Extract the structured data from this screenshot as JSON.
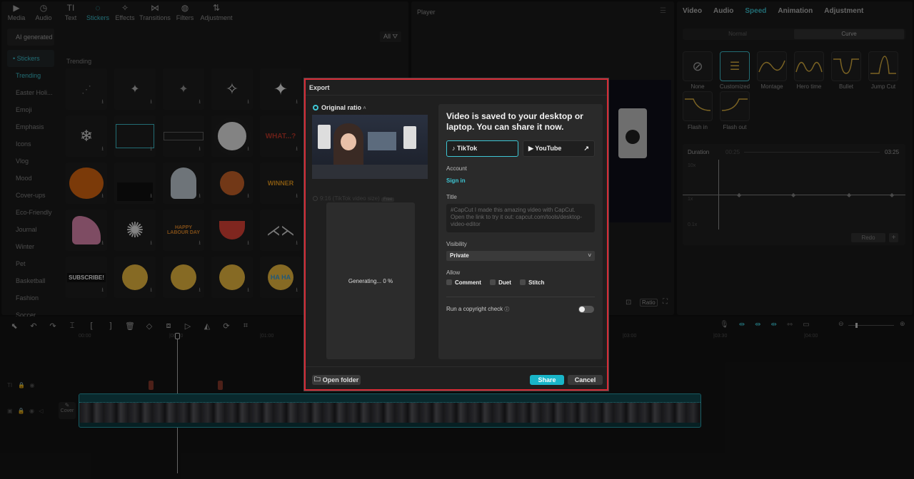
{
  "media_tabs": [
    {
      "label": "Media",
      "icon": "media-icon",
      "glyph": "▶"
    },
    {
      "label": "Audio",
      "icon": "audio-icon",
      "glyph": "◷"
    },
    {
      "label": "Text",
      "icon": "text-icon",
      "glyph": "TI"
    },
    {
      "label": "Stickers",
      "icon": "stickers-icon",
      "glyph": "◌"
    },
    {
      "label": "Effects",
      "icon": "effects-icon",
      "glyph": "✧"
    },
    {
      "label": "Transitions",
      "icon": "transitions-icon",
      "glyph": "⋈"
    },
    {
      "label": "Filters",
      "icon": "filters-icon",
      "glyph": "◍"
    },
    {
      "label": "Adjustment",
      "icon": "adjustment-icon",
      "glyph": "⇅"
    }
  ],
  "sticker_nav": {
    "ai_generated": "AI generated",
    "stickers": "• Stickers",
    "items": [
      "Trending",
      "Easter Holi...",
      "Emoji",
      "Emphasis",
      "Icons",
      "Vlog",
      "Mood",
      "Cover-ups",
      "Eco-Friendly",
      "Journal",
      "Winter",
      "Pet",
      "Basketball",
      "Fashion",
      "Soccer"
    ]
  },
  "sticker_panel": {
    "section_title": "Trending",
    "filter_label": "All"
  },
  "sticker_texts": {
    "what": "WHAT...?",
    "winner": "WINNER",
    "labour": "HAPPY LABOUR DAY",
    "subscribe": "SUBSCRIBE!",
    "haha": "HA HA"
  },
  "player": {
    "title": "Player",
    "ratio_label": "Ratio"
  },
  "right_panel": {
    "tabs": [
      "Video",
      "Audio",
      "Speed",
      "Animation",
      "Adjustment"
    ],
    "active_tab": "Speed",
    "mode_normal": "Normal",
    "mode_curve": "Curve",
    "curves": [
      "None",
      "Customized",
      "Montage",
      "Hero time",
      "Bullet",
      "Jump Cut",
      "Flash in",
      "Flash out"
    ],
    "duration_label": "Duration",
    "duration_start": "00:25",
    "duration_end": "03:25",
    "speed_labels": [
      "10x",
      "1x",
      "0.1x"
    ],
    "redo_label": "Redo"
  },
  "timeline": {
    "ruler_marks": [
      "00:00",
      "|00:30",
      "|01:00",
      "|01:30",
      "|02:00",
      "|02:30",
      "|03:00",
      "|03:30",
      "|04:00"
    ],
    "cover_label": "Cover"
  },
  "export_dialog": {
    "title": "Export",
    "original_ratio": "Original ratio",
    "alt_ratio": "9:16 (TikTok video size)",
    "alt_ratio_tag": "Free",
    "generating": "Generating... 0 %",
    "headline": "Video is saved to your desktop or laptop. You can share it now.",
    "tiktok": "TikTok",
    "youtube": "YouTube",
    "account_label": "Account",
    "sign_in": "Sign in",
    "title_label": "Title",
    "title_text": "#CapCut I made this amazing video with CapCut. Open the link to try it out: capcut.com/tools/desktop-video-editor",
    "visibility_label": "Visibility",
    "visibility_value": "Private",
    "allow_label": "Allow",
    "allow_options": [
      "Comment",
      "Duet",
      "Stitch"
    ],
    "copyright_label": "Run a copyright check",
    "open_folder": "Open folder",
    "share": "Share",
    "cancel": "Cancel"
  },
  "colors": {
    "accent": "#3ec6d4",
    "danger_border": "#d62b36",
    "share_button": "#19b5c8"
  }
}
